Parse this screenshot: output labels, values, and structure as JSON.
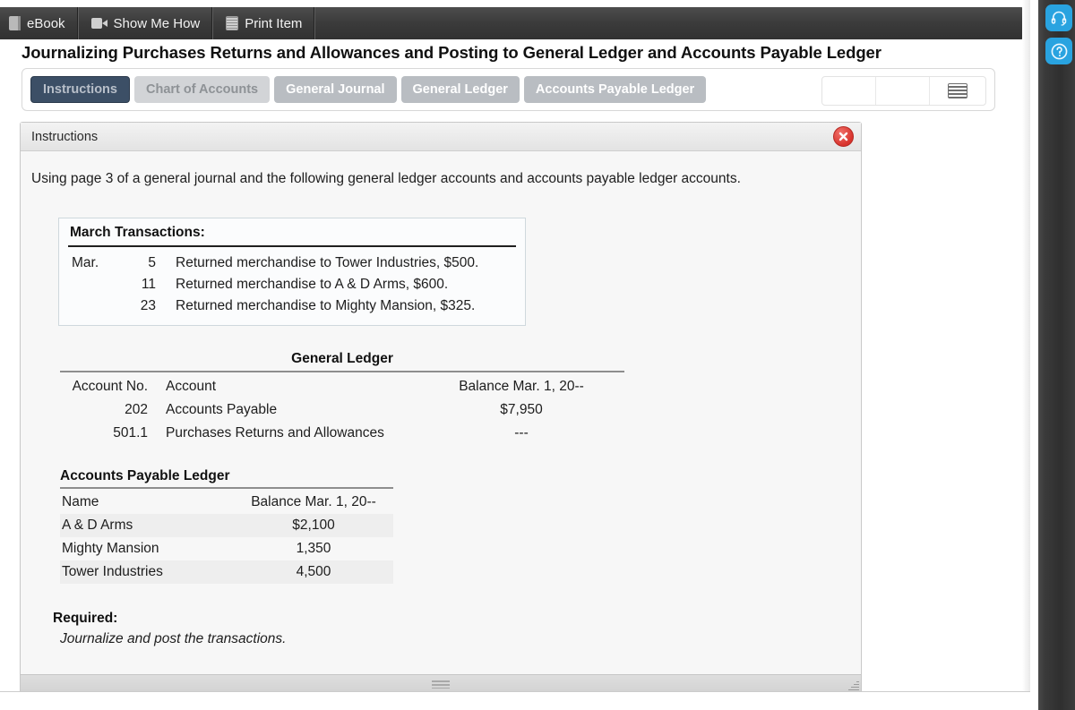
{
  "toolbar": {
    "items": [
      {
        "icon": "book-icon",
        "label": "eBook"
      },
      {
        "icon": "video-icon",
        "label": "Show Me How"
      },
      {
        "icon": "print-icon",
        "label": "Print Item"
      }
    ]
  },
  "header": {
    "title": "Journalizing Purchases Returns and Allowances and Posting to General Ledger and Accounts Payable Ledger"
  },
  "tabs": [
    {
      "label": "Instructions",
      "state": "active"
    },
    {
      "label": "Chart of Accounts",
      "state": "muted"
    },
    {
      "label": "General Journal",
      "state": "normal"
    },
    {
      "label": "General Ledger",
      "state": "normal"
    },
    {
      "label": "Accounts Payable Ledger",
      "state": "normal"
    }
  ],
  "toolbar_right": {
    "box1_label": "",
    "box2_label": "",
    "box3_icon": "list-menu-icon"
  },
  "panel": {
    "title": "Instructions",
    "close_icon": "close-icon",
    "lead": "Using page 3 of a general journal and the following general ledger accounts and accounts payable ledger accounts."
  },
  "march_transactions": {
    "title": "March Transactions:",
    "rows": [
      {
        "month": "Mar.",
        "day": "5",
        "description": "Returned merchandise to Tower Industries, $500."
      },
      {
        "month": "",
        "day": "11",
        "description": "Returned merchandise to A & D Arms, $600."
      },
      {
        "month": "",
        "day": "23",
        "description": "Returned merchandise to Mighty Mansion, $325."
      }
    ]
  },
  "general_ledger": {
    "title": "General Ledger",
    "headers": {
      "account_no": "Account No.",
      "account": "Account",
      "balance": "Balance Mar. 1, 20--"
    },
    "rows": [
      {
        "account_no": "202",
        "account": "Accounts Payable",
        "balance": "$7,950"
      },
      {
        "account_no": "501.1",
        "account": "Purchases Returns and Allowances",
        "balance": "---"
      }
    ]
  },
  "accounts_payable_ledger": {
    "title": "Accounts Payable Ledger",
    "headers": {
      "name": "Name",
      "balance": "Balance Mar. 1, 20--"
    },
    "rows": [
      {
        "name": "A & D Arms",
        "balance": "$2,100"
      },
      {
        "name": "Mighty Mansion",
        "balance": "1,350"
      },
      {
        "name": "Tower Industries",
        "balance": "4,500"
      }
    ]
  },
  "required": {
    "title": "Required:",
    "text": "Journalize and post the transactions."
  },
  "rail": {
    "buttons": [
      {
        "icon": "headset-icon",
        "name": "support-button"
      },
      {
        "icon": "help-icon",
        "name": "help-button"
      }
    ]
  },
  "colors": {
    "accent_blue": "#29a3e0",
    "tab_active": "#3c4f66",
    "close_red": "#d8332c"
  }
}
